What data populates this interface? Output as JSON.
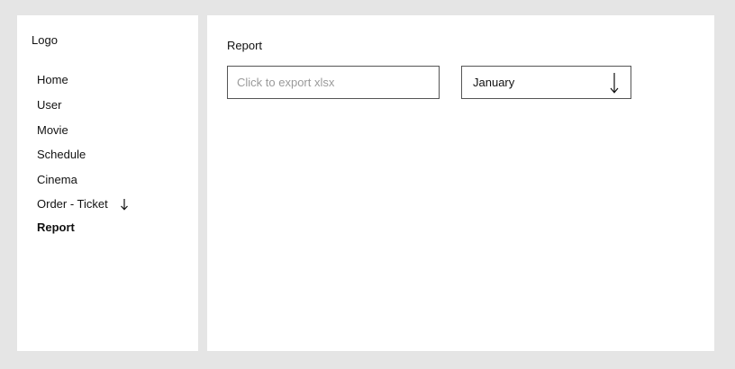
{
  "sidebar": {
    "logo": "Logo",
    "items": [
      {
        "label": "Home"
      },
      {
        "label": "User"
      },
      {
        "label": "Movie"
      },
      {
        "label": "Schedule"
      },
      {
        "label": "Cinema"
      },
      {
        "label": "Order - Ticket",
        "icon": "arrow-down-icon"
      },
      {
        "label": "Report",
        "active": true
      }
    ]
  },
  "main": {
    "title": "Report",
    "export_input": {
      "value": "",
      "placeholder": "Click to export xlsx"
    },
    "month_select": {
      "selected": "January",
      "icon": "arrow-down-icon"
    }
  },
  "colors": {
    "background": "#e5e5e5",
    "panel": "#ffffff",
    "border": "#555555",
    "placeholder": "#9a9a9a",
    "text": "#111111"
  }
}
